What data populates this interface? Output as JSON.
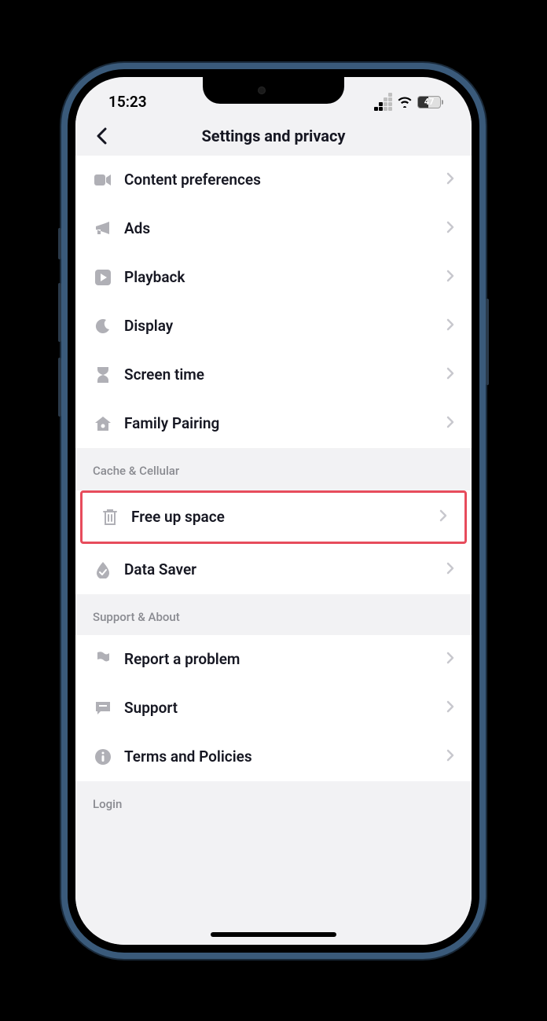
{
  "status": {
    "time": "15:23",
    "battery": "47"
  },
  "header": {
    "title": "Settings and privacy"
  },
  "sections": {
    "top": {
      "items": [
        {
          "icon": "video",
          "label": "Content preferences"
        },
        {
          "icon": "megaphone",
          "label": "Ads"
        },
        {
          "icon": "play",
          "label": "Playback"
        },
        {
          "icon": "moon",
          "label": "Display"
        },
        {
          "icon": "hourglass",
          "label": "Screen time"
        },
        {
          "icon": "home",
          "label": "Family Pairing"
        }
      ]
    },
    "cache": {
      "title": "Cache & Cellular",
      "items": [
        {
          "icon": "trash",
          "label": "Free up space",
          "highlight": true
        },
        {
          "icon": "droplet",
          "label": "Data Saver"
        }
      ]
    },
    "support": {
      "title": "Support & About",
      "items": [
        {
          "icon": "flag",
          "label": "Report a problem"
        },
        {
          "icon": "chat",
          "label": "Support"
        },
        {
          "icon": "info",
          "label": "Terms and Policies"
        }
      ]
    },
    "login": {
      "title": "Login"
    }
  }
}
